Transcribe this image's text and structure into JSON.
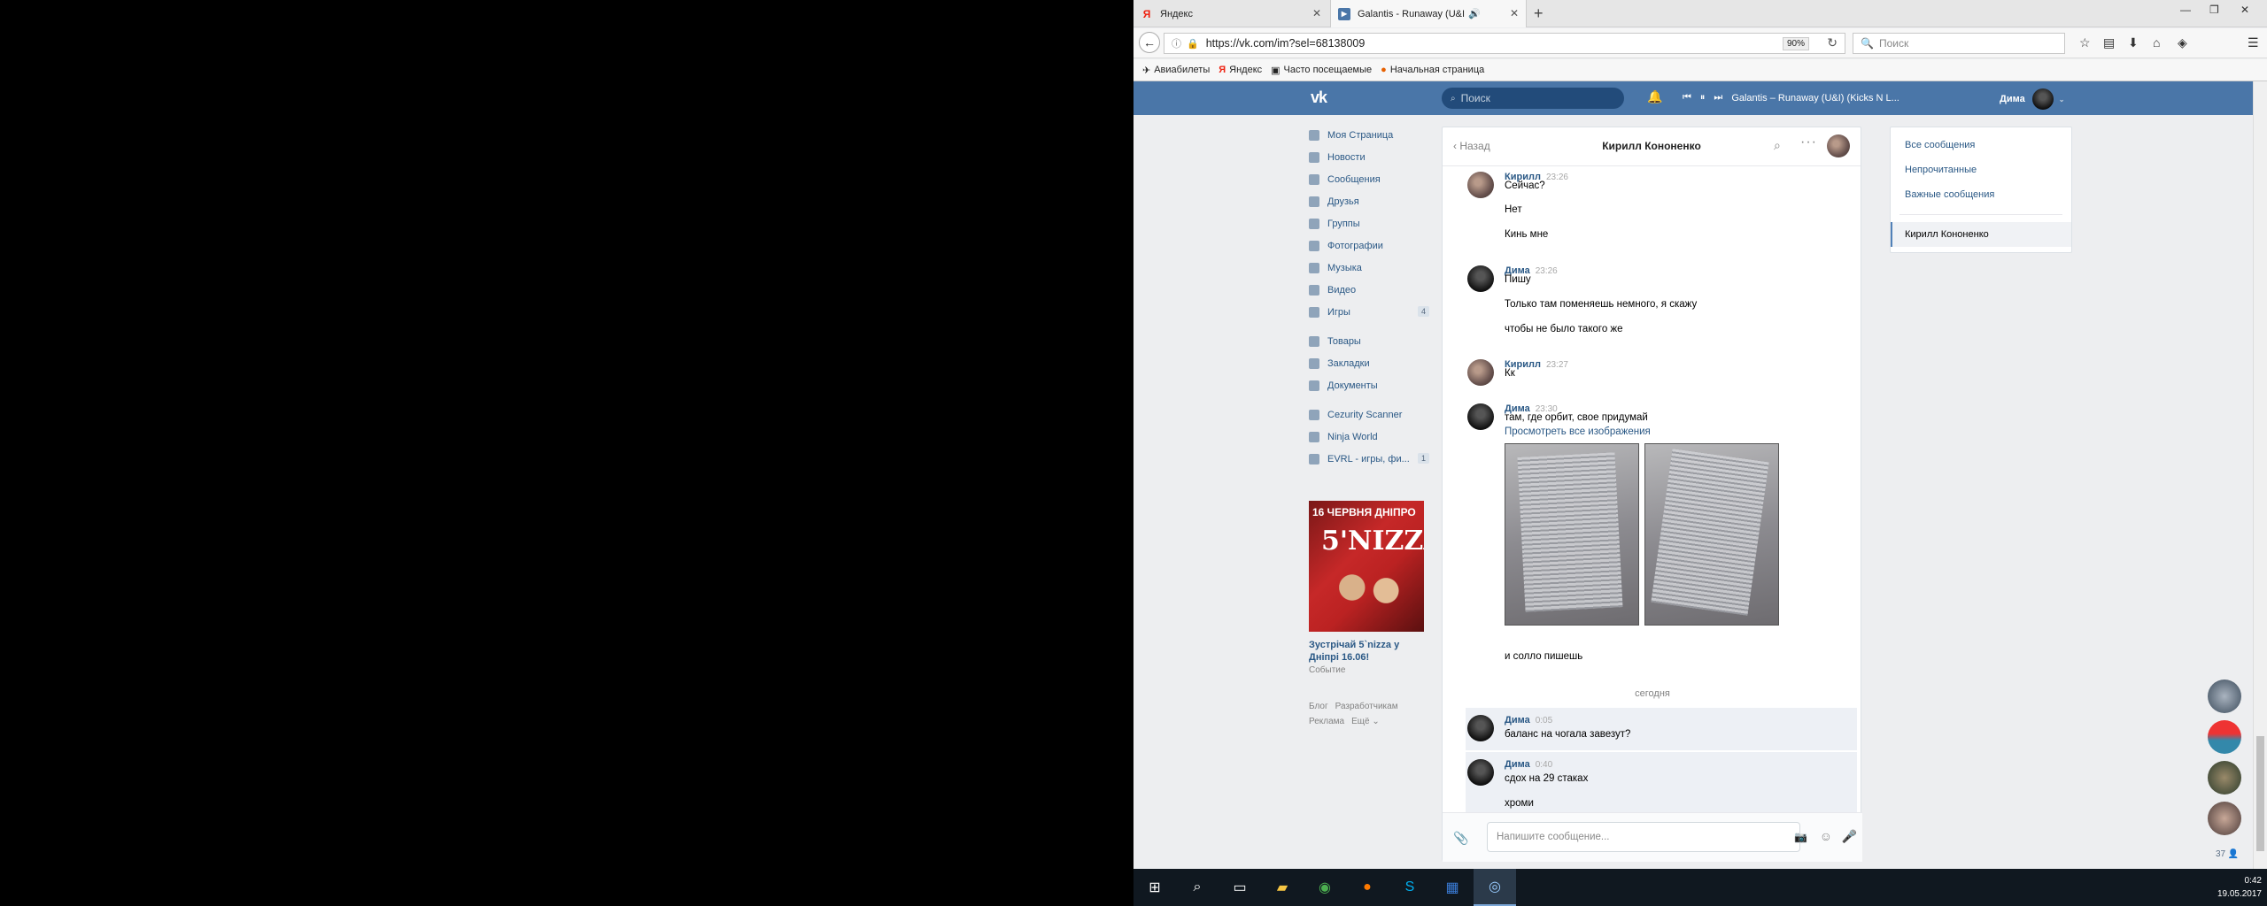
{
  "browser": {
    "tabs": [
      {
        "title": "Яндекс",
        "icon": "yandex-icon"
      },
      {
        "title": "Galantis - Runaway (U&I",
        "icon": "vk-tab-icon",
        "audio": "🔊"
      }
    ],
    "url": "https://vk.com/im?sel=68138009",
    "zoom": "90%",
    "search_placeholder": "Поиск",
    "bookmarks": [
      "Авиабилеты",
      "Яндекс",
      "Часто посещаемые",
      "Начальная страница"
    ]
  },
  "vk": {
    "search_placeholder": "Поиск",
    "player_track": "Galantis – Runaway (U&I) (Kicks N L...",
    "user_name": "Дима",
    "left_menu": [
      {
        "label": "Моя Страница"
      },
      {
        "label": "Новости"
      },
      {
        "label": "Сообщения"
      },
      {
        "label": "Друзья"
      },
      {
        "label": "Группы"
      },
      {
        "label": "Фотографии"
      },
      {
        "label": "Музыка"
      },
      {
        "label": "Видео"
      },
      {
        "label": "Игры",
        "count": "4"
      },
      {
        "label": "Товары"
      },
      {
        "label": "Закладки"
      },
      {
        "label": "Документы"
      },
      {
        "label": "Cezurity Scanner"
      },
      {
        "label": "Ninja World"
      },
      {
        "label": "EVRL - игры, фи...",
        "count": "1"
      }
    ],
    "ad": {
      "banner_top": "16 ЧЕРВНЯ ДНІПРО",
      "banner_brand": "5'NIZZA",
      "title": "Зустрічай 5`nizza у Дніпрі 16.06!",
      "subtitle": "Событие"
    },
    "footer": [
      "Блог",
      "Разработчикам",
      "Реклама",
      "Ещё ⌄"
    ]
  },
  "chat": {
    "back": "Назад",
    "title": "Кирилл Кононенко",
    "messages": [
      {
        "name": "Кирилл",
        "time": "23:26",
        "lines": [
          "Сейчас?",
          "Нет",
          "Кинь мне"
        ]
      },
      {
        "name": "Дима",
        "time": "23:26",
        "lines": [
          "Пишу",
          "Только там поменяешь немного, я скажу",
          "чтобы не было такого же"
        ]
      },
      {
        "name": "Кирилл",
        "time": "23:27",
        "lines": [
          "Кк"
        ]
      },
      {
        "name": "Дима",
        "time": "23:30",
        "lines": [
          "там, где орбит, свое придумай"
        ],
        "link": "Просмотреть все изображения",
        "after": "и солло пишешь"
      }
    ],
    "divider": "сегодня",
    "today_messages": [
      {
        "name": "Дима",
        "time": "0:05",
        "lines": [
          "баланс на чогала завезут?"
        ]
      },
      {
        "name": "Дима",
        "time": "0:40",
        "lines": [
          "сдох на 29 стаках",
          "хроми"
        ]
      }
    ],
    "input_placeholder": "Напишите сообщение..."
  },
  "right_menu": {
    "items": [
      "Все сообщения",
      "Непрочитанные",
      "Важные сообщения"
    ],
    "active": "Кирилл Кононенко"
  },
  "side_count": "37 👤",
  "taskbar": {
    "time": "0:42",
    "date": "19.05.2017"
  }
}
